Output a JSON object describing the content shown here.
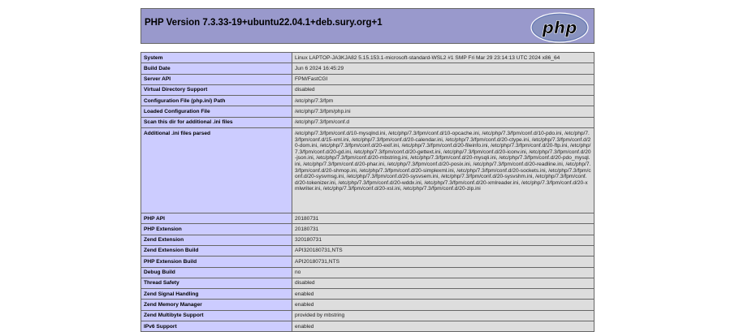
{
  "page": {
    "title": "PHP Version 7.3.33-19+ubuntu22.04.1+deb.sury.org+1",
    "logo_text": "php"
  },
  "rows": [
    {
      "label": "System",
      "value": "Linux LAPTOP-JA3KJA82 5.15.153.1-microsoft-standard-WSL2 #1 SMP Fri Mar 29 23:14:13 UTC 2024 x86_64"
    },
    {
      "label": "Build Date",
      "value": "Jun 6 2024 16:45:29"
    },
    {
      "label": "Server API",
      "value": "FPM/FastCGI"
    },
    {
      "label": "Virtual Directory Support",
      "value": "disabled"
    },
    {
      "label": "Configuration File (php.ini) Path",
      "value": "/etc/php/7.3/fpm"
    },
    {
      "label": "Loaded Configuration File",
      "value": "/etc/php/7.3/fpm/php.ini"
    },
    {
      "label": "Scan this dir for additional .ini files",
      "value": "/etc/php/7.3/fpm/conf.d"
    },
    {
      "label": "Additional .ini files parsed",
      "value": "/etc/php/7.3/fpm/conf.d/10-mysqlnd.ini, /etc/php/7.3/fpm/conf.d/10-opcache.ini, /etc/php/7.3/fpm/conf.d/10-pdo.ini, /etc/php/7.3/fpm/conf.d/15-xml.ini, /etc/php/7.3/fpm/conf.d/20-calendar.ini, /etc/php/7.3/fpm/conf.d/20-ctype.ini, /etc/php/7.3/fpm/conf.d/20-dom.ini, /etc/php/7.3/fpm/conf.d/20-exif.ini, /etc/php/7.3/fpm/conf.d/20-fileinfo.ini, /etc/php/7.3/fpm/conf.d/20-ftp.ini, /etc/php/7.3/fpm/conf.d/20-gd.ini, /etc/php/7.3/fpm/conf.d/20-gettext.ini, /etc/php/7.3/fpm/conf.d/20-iconv.ini, /etc/php/7.3/fpm/conf.d/20-json.ini, /etc/php/7.3/fpm/conf.d/20-mbstring.ini, /etc/php/7.3/fpm/conf.d/20-mysqli.ini, /etc/php/7.3/fpm/conf.d/20-pdo_mysql.ini, /etc/php/7.3/fpm/conf.d/20-phar.ini, /etc/php/7.3/fpm/conf.d/20-posix.ini, /etc/php/7.3/fpm/conf.d/20-readline.ini, /etc/php/7.3/fpm/conf.d/20-shmop.ini, /etc/php/7.3/fpm/conf.d/20-simplexml.ini, /etc/php/7.3/fpm/conf.d/20-sockets.ini, /etc/php/7.3/fpm/conf.d/20-sysvmsg.ini, /etc/php/7.3/fpm/conf.d/20-sysvsem.ini, /etc/php/7.3/fpm/conf.d/20-sysvshm.ini, /etc/php/7.3/fpm/conf.d/20-tokenizer.ini, /etc/php/7.3/fpm/conf.d/20-wddx.ini, /etc/php/7.3/fpm/conf.d/20-xmlreader.ini, /etc/php/7.3/fpm/conf.d/20-xmlwriter.ini, /etc/php/7.3/fpm/conf.d/20-xsl.ini, /etc/php/7.3/fpm/conf.d/20-zip.ini"
    },
    {
      "label": "PHP API",
      "value": "20180731"
    },
    {
      "label": "PHP Extension",
      "value": "20180731"
    },
    {
      "label": "Zend Extension",
      "value": "320180731"
    },
    {
      "label": "Zend Extension Build",
      "value": "API320180731,NTS"
    },
    {
      "label": "PHP Extension Build",
      "value": "API20180731,NTS"
    },
    {
      "label": "Debug Build",
      "value": "no"
    },
    {
      "label": "Thread Safety",
      "value": "disabled"
    },
    {
      "label": "Zend Signal Handling",
      "value": "enabled"
    },
    {
      "label": "Zend Memory Manager",
      "value": "enabled"
    },
    {
      "label": "Zend Multibyte Support",
      "value": "provided by mbstring"
    },
    {
      "label": "IPv6 Support",
      "value": "enabled"
    }
  ]
}
